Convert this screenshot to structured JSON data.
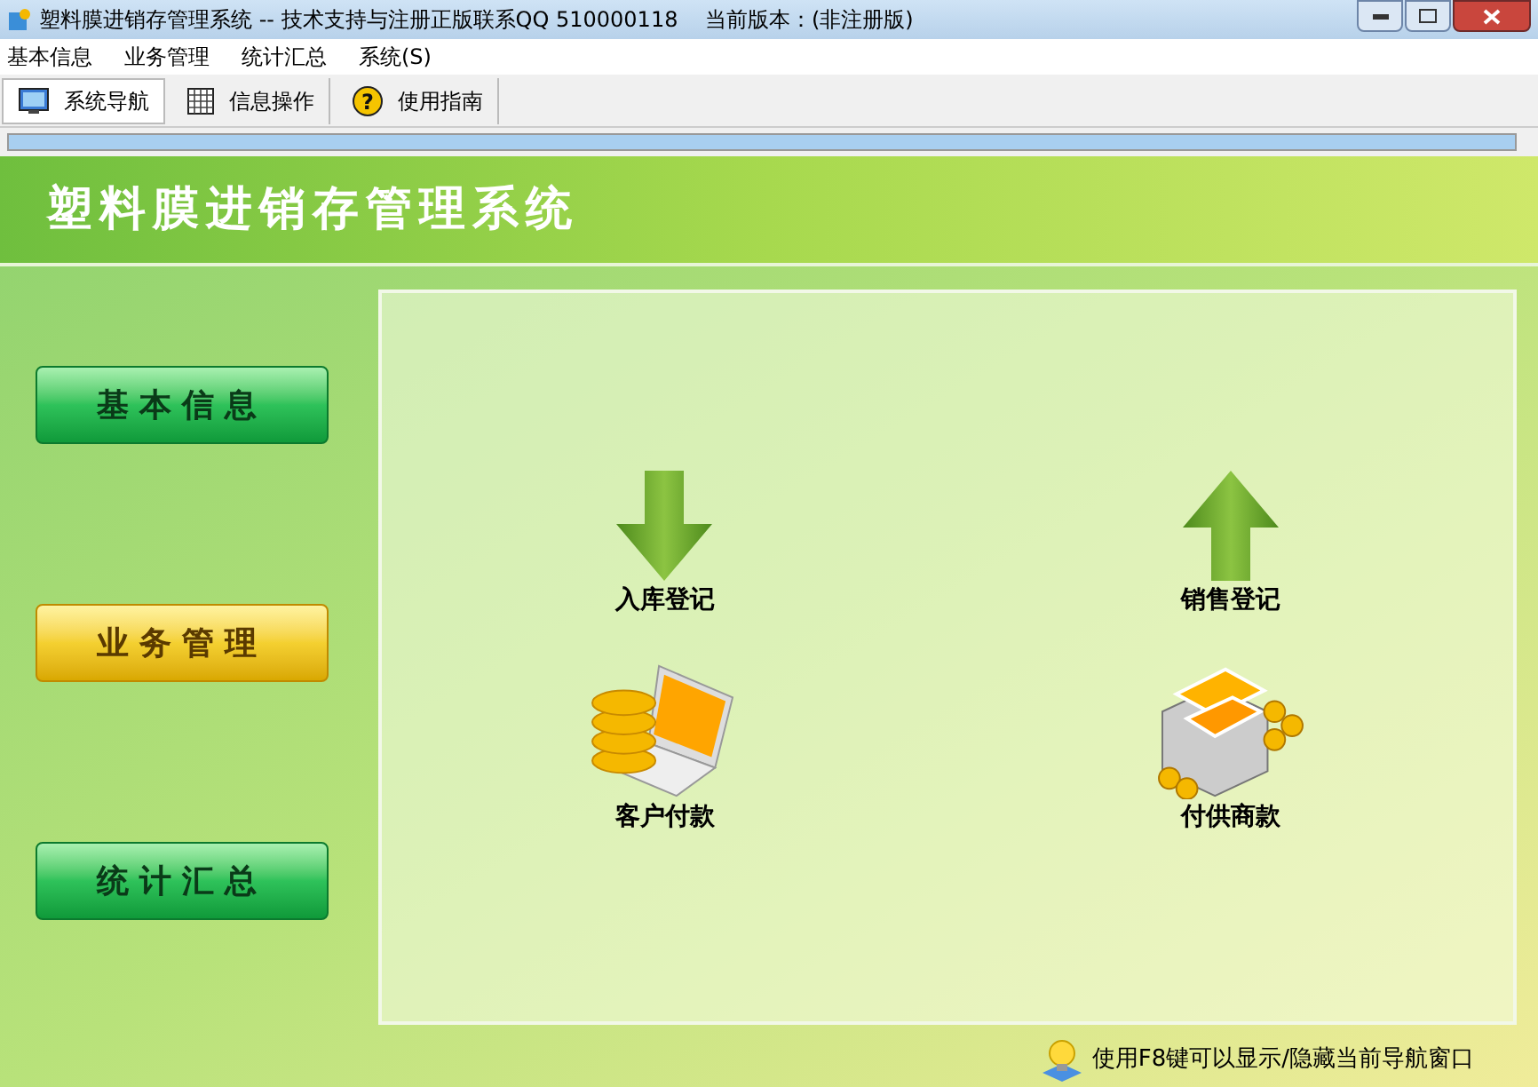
{
  "window": {
    "title": "塑料膜进销存管理系统 -- 技术支持与注册正版联系QQ 510000118    当前版本：(非注册版)"
  },
  "menu": [
    "基本信息",
    "业务管理",
    "统计汇总",
    "系统(S)"
  ],
  "toolbar": [
    {
      "label": "系统导航",
      "kind": "monitor",
      "selected": true
    },
    {
      "label": "信息操作",
      "kind": "grid",
      "selected": false
    },
    {
      "label": "使用指南",
      "kind": "help",
      "glyph": "?",
      "selected": false
    }
  ],
  "banner": {
    "title": "塑料膜进销存管理系统"
  },
  "nav": [
    {
      "label": "基本信息",
      "selected": false
    },
    {
      "label": "业务管理",
      "selected": true
    },
    {
      "label": "统计汇总",
      "selected": false
    }
  ],
  "actions": [
    {
      "label": "入库登记",
      "kind": "arrow-down"
    },
    {
      "label": "销售登记",
      "kind": "arrow-up"
    },
    {
      "label": "客户付款",
      "kind": "laptop-coins"
    },
    {
      "label": "付供商款",
      "kind": "cash-box"
    }
  ],
  "hint": "使用F8键可以显示/隐藏当前导航窗口"
}
